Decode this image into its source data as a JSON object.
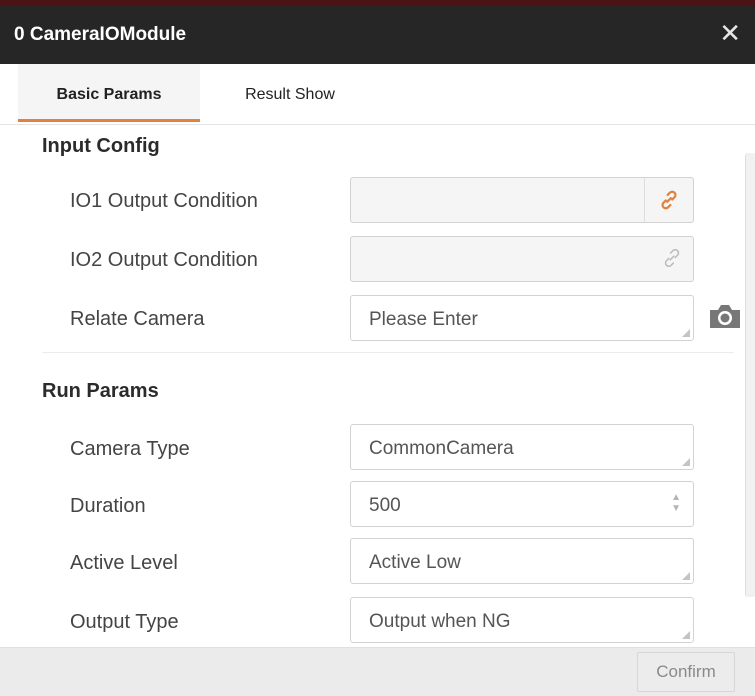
{
  "window": {
    "title": "0 CameraIOModule",
    "close_symbol": "✕"
  },
  "tabs": [
    {
      "label": "Basic Params",
      "active": true
    },
    {
      "label": "Result Show",
      "active": false
    }
  ],
  "input_config": {
    "title": "Input Config",
    "fields": [
      {
        "label": "IO1 Output Condition",
        "value": "",
        "icon": "link-icon",
        "icon_color": "#e0823e"
      },
      {
        "label": "IO2 Output Condition",
        "value": "",
        "icon": "link-icon",
        "icon_color": "#b8b8b8"
      },
      {
        "label": "Relate Camera",
        "placeholder": "Please Enter",
        "icon": "camera-icon"
      }
    ]
  },
  "run_params": {
    "title": "Run Params",
    "fields": [
      {
        "label": "Camera Type",
        "value": "CommonCamera"
      },
      {
        "label": "Duration",
        "value": "500"
      },
      {
        "label": "Active Level",
        "value": "Active Low"
      },
      {
        "label": "Output Type",
        "value": "Output when NG"
      }
    ]
  },
  "footer": {
    "confirm_label": "Confirm"
  },
  "colors": {
    "accent": "#e0823e",
    "titlebar": "#262626"
  }
}
